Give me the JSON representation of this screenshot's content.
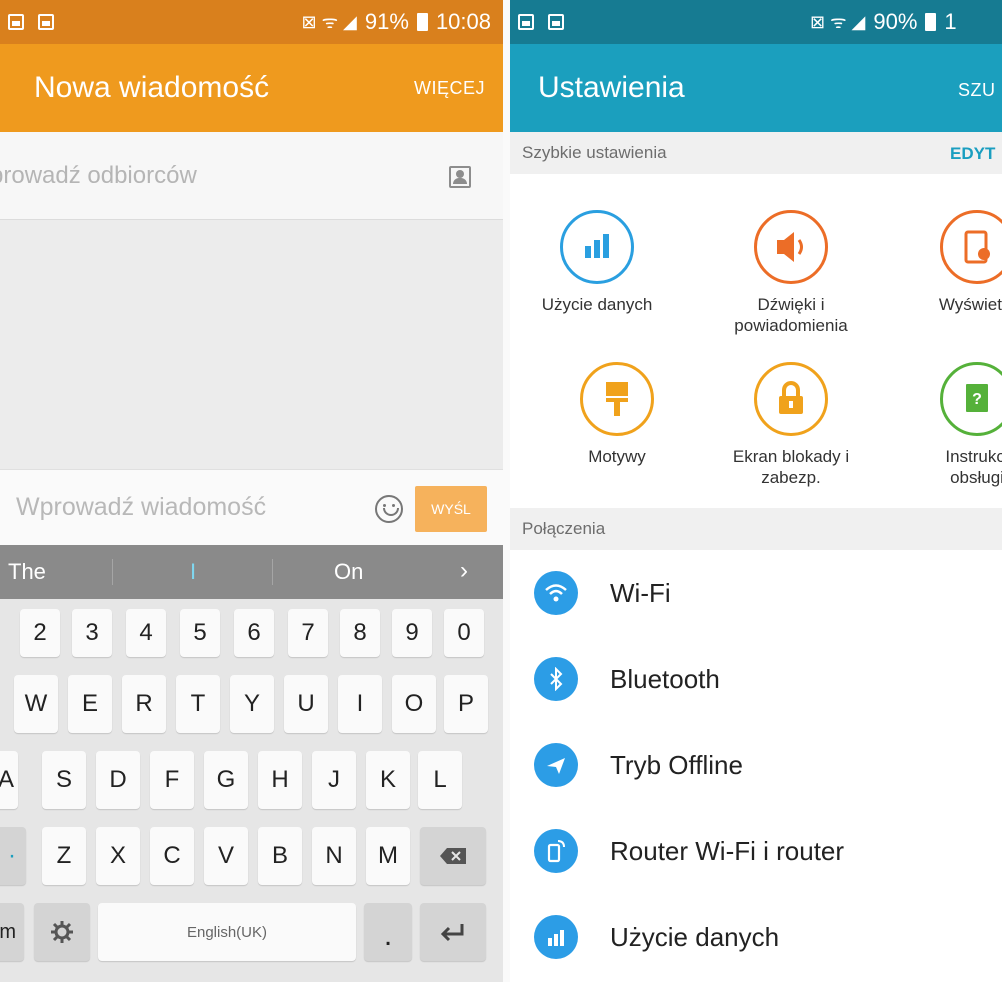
{
  "left": {
    "status": {
      "indicators": "⊠ ᯤ ◢",
      "battery": "91%",
      "time": "10:08"
    },
    "toolbar": {
      "title": "Nowa wiadomość",
      "more": "WIĘCEJ"
    },
    "recipient": {
      "placeholder": "prowadź odbiorców"
    },
    "compose": {
      "placeholder": "Wprowadź wiadomość",
      "send": "WYŚL"
    },
    "suggestions": [
      "The",
      "I",
      "On"
    ],
    "keyboard": {
      "number_row": [
        "2",
        "3",
        "4",
        "5",
        "6",
        "7",
        "8",
        "9",
        "0"
      ],
      "row1": [
        "W",
        "E",
        "R",
        "T",
        "Y",
        "U",
        "I",
        "O",
        "P"
      ],
      "row2": [
        "A",
        "S",
        "D",
        "F",
        "G",
        "H",
        "J",
        "K",
        "L"
      ],
      "row3": [
        "Z",
        "X",
        "C",
        "V",
        "B",
        "N",
        "M"
      ],
      "bottom": {
        "sym": "m",
        "space": "English(UK)",
        "period": "."
      }
    }
  },
  "right": {
    "status": {
      "indicators": "⊠ ᯤ ◢",
      "battery": "90%",
      "time": "1"
    },
    "toolbar": {
      "title": "Ustawienia",
      "search": "SZU"
    },
    "quick": {
      "header": "Szybkie ustawienia",
      "edit": "EDYT",
      "items": [
        {
          "label": "Użycie danych",
          "color": "#2a9fe0"
        },
        {
          "label": "Dźwięki i\npowiadomienia",
          "color": "#ec6d27"
        },
        {
          "label": "Wyświetla",
          "color": "#ec6d27"
        },
        {
          "label": "Motywy",
          "color": "#f0a21c"
        },
        {
          "label": "Ekran blokady i\nzabezp.",
          "color": "#f0a21c"
        },
        {
          "label": "Instrukcj\nobsługi",
          "color": "#55b13a"
        }
      ]
    },
    "connections": {
      "header": "Połączenia",
      "items": [
        {
          "label": "Wi-Fi"
        },
        {
          "label": "Bluetooth"
        },
        {
          "label": "Tryb Offline"
        },
        {
          "label": "Router Wi-Fi i router"
        },
        {
          "label": "Użycie danych"
        }
      ]
    }
  }
}
